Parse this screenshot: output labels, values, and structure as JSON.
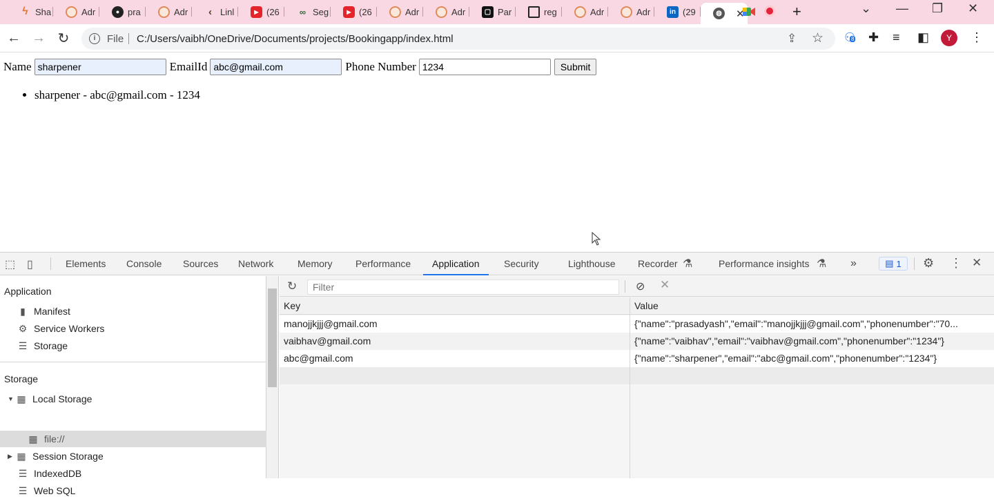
{
  "browser": {
    "tabs": [
      {
        "label": "Sha",
        "icon": "ai-bolt-icon"
      },
      {
        "label": "Adr",
        "icon": "adr-circle-icon"
      },
      {
        "label": "pra",
        "icon": "github-icon"
      },
      {
        "label": "Adr",
        "icon": "adr-circle-icon"
      },
      {
        "label": "Linl",
        "icon": "link-icon"
      },
      {
        "label": "(26",
        "icon": "youtube-icon"
      },
      {
        "label": "Seg",
        "icon": "seg-icon"
      },
      {
        "label": "(26",
        "icon": "youtube-icon"
      },
      {
        "label": "Adr",
        "icon": "adr-circle-icon"
      },
      {
        "label": "Adr",
        "icon": "adr-circle-icon"
      },
      {
        "label": "Par",
        "icon": "par-icon"
      },
      {
        "label": "reg",
        "icon": "reg-icon"
      },
      {
        "label": "Adr",
        "icon": "adr-circle-icon"
      },
      {
        "label": "Adr",
        "icon": "adr-circle-icon"
      },
      {
        "label": "(29",
        "icon": "linkedin-icon"
      }
    ],
    "active_tab_close": "✕",
    "new_tab": "+",
    "url_scheme": "File",
    "url": "C:/Users/vaibh/OneDrive/Documents/projects/Bookingapp/index.html",
    "extension_badge": "8",
    "profile_initial": "Y"
  },
  "page": {
    "name_label": "Name",
    "name_value": "sharpener",
    "email_label": "EmailId",
    "email_value": "abc@gmail.com",
    "phone_label": "Phone Number",
    "phone_value": "1234",
    "submit_label": "Submit",
    "users": [
      "sharpener - abc@gmail.com - 1234"
    ]
  },
  "devtools": {
    "tabs": [
      "Elements",
      "Console",
      "Sources",
      "Network",
      "Memory",
      "Performance",
      "Application",
      "Security",
      "Lighthouse",
      "Recorder",
      "Performance insights"
    ],
    "active_tab": "Application",
    "more": "»",
    "messages_count": "1",
    "sidebar": {
      "application_heading": "Application",
      "application_items": [
        "Manifest",
        "Service Workers",
        "Storage"
      ],
      "storage_heading": "Storage",
      "local_storage": "Local Storage",
      "local_storage_child": "file://",
      "session_storage": "Session Storage",
      "indexeddb": "IndexedDB",
      "websql": "Web SQL"
    },
    "filter_placeholder": "Filter",
    "columns": {
      "key": "Key",
      "value": "Value"
    },
    "rows": [
      {
        "key": "manojjkjjj@gmail.com",
        "value": "{\"name\":\"prasadyash\",\"email\":\"manojjkjjj@gmail.com\",\"phonenumber\":\"70..."
      },
      {
        "key": "vaibhav@gmail.com",
        "value": "{\"name\":\"vaibhav\",\"email\":\"vaibhav@gmail.com\",\"phonenumber\":\"1234\"}"
      },
      {
        "key": "abc@gmail.com",
        "value": "{\"name\":\"sharpener\",\"email\":\"abc@gmail.com\",\"phonenumber\":\"1234\"}"
      }
    ]
  },
  "colors": {
    "tabstrip": "#f9d8e4",
    "accent": "#1a73e8",
    "autofill": "#e8f0fe"
  }
}
